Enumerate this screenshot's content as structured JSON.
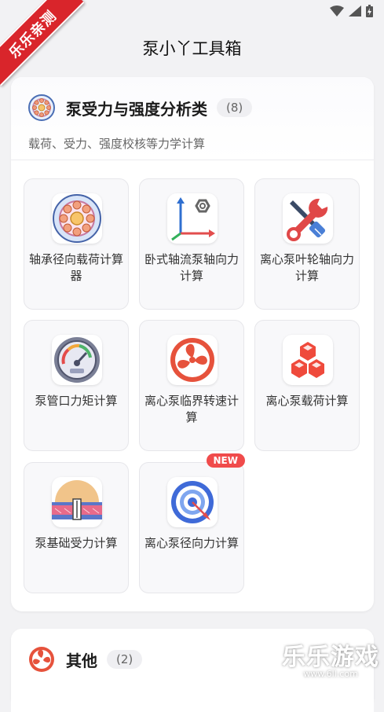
{
  "ribbon": {
    "text": "乐乐亲测"
  },
  "app": {
    "title": "泵小丫工具箱"
  },
  "section_main": {
    "title": "泵受力与强度分析类",
    "count": "(8)",
    "description": "载荷、受力、强度校核等力学计算",
    "icon": "bearing-icon"
  },
  "tools": [
    {
      "label": "轴承径向载荷计算器",
      "icon": "bearing-icon"
    },
    {
      "label": "卧式轴流泵轴向力计算",
      "icon": "axes-bolt-icon"
    },
    {
      "label": "离心泵叶轮轴向力计算",
      "icon": "wrench-screwdriver-icon"
    },
    {
      "label": "泵管口力矩计算",
      "icon": "gauge-icon"
    },
    {
      "label": "离心泵临界转速计算",
      "icon": "fan-icon"
    },
    {
      "label": "离心泵载荷计算",
      "icon": "cubes-icon"
    },
    {
      "label": "泵基础受力计算",
      "icon": "foundation-icon"
    },
    {
      "label": "离心泵径向力计算",
      "icon": "target-icon",
      "badge": "NEW"
    }
  ],
  "section_other": {
    "title": "其他",
    "count": "(2)",
    "icon": "fan-icon"
  },
  "watermark": {
    "main": "乐乐游戏",
    "sub": "www.6ll.com"
  },
  "colors": {
    "accent": "#e6523c",
    "badge": "#f04b4b",
    "ribbon": "#d9252b"
  }
}
